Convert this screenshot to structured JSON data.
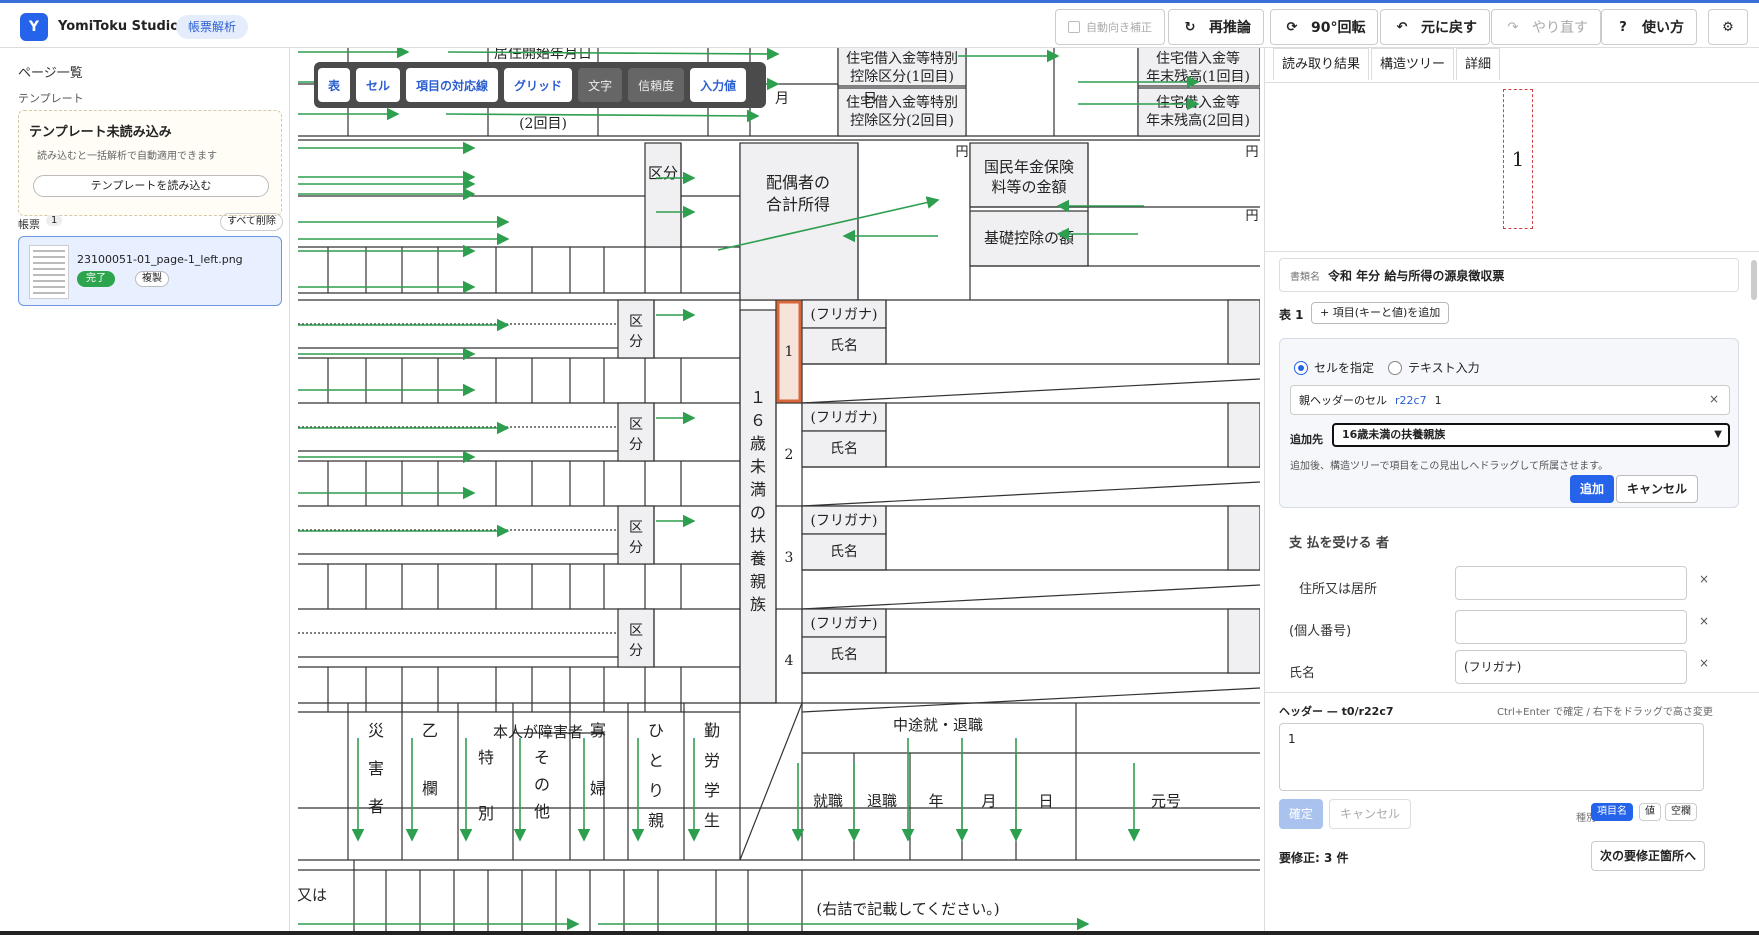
{
  "header": {
    "logo_letter": "Y",
    "app_title": "YomiToku Studio",
    "mode_badge": "帳票解析",
    "auto_orient_label": "自動向き補正",
    "reinfer_label": "再推論",
    "rotate_label": "90°回転",
    "undo_label": "元に戻す",
    "redo_label": "やり直す",
    "help_label": "使い方",
    "settings_icon": "gear-icon"
  },
  "sidebar": {
    "page_list_title": "ページ一覧",
    "template_label": "テンプレート",
    "template_box": {
      "title": "テンプレート未読み込み",
      "desc": "読み込むと一括解析で自動適用できます",
      "load_button": "テンプレートを読み込む"
    },
    "forms_label": "帳票",
    "forms_count": "1",
    "delete_all": "すべて削除",
    "file": {
      "name": "23100051-01_page-1_left.png",
      "status": "完了",
      "duplicate": "複製"
    }
  },
  "toolbar": {
    "items": [
      "表",
      "セル",
      "項目の対応線",
      "グリッド",
      "文字",
      "信頼度",
      "入力値"
    ]
  },
  "document": {
    "texts": {
      "resident_start_1": "居住開始年月日",
      "resident_start_2": "(2回目)",
      "loan_class_1": "住宅借入金等特別",
      "loan_class_1b": "控除区分(1回目)",
      "loan_class_2": "住宅借入金等特別",
      "loan_class_2b": "控除区分(2回目)",
      "loan_bal_1": "住宅借入金等",
      "loan_bal_1b": "年末残高(1回目)",
      "loan_bal_2": "住宅借入金等",
      "loan_bal_2b": "年末残高(2回目)",
      "month": "月",
      "day": "日",
      "yen": "円",
      "spouse_income": "配偶者の",
      "spouse_income_b": "合計所得",
      "pension": "国民年金保険",
      "pension_b": "料等の金額",
      "basic_deduction": "基礎控除の額",
      "kubun": "区分",
      "furigana": "(フリガナ)",
      "shimei": "氏名",
      "dependents_vertical": "16歳未満の扶養親族",
      "row_numbers": [
        "1",
        "2",
        "3",
        "4"
      ],
      "disaster": "災害者",
      "otsu": "乙欄",
      "self_disabled": "本人が障害者",
      "special": "特別",
      "other": "その他",
      "widow": "寡婦",
      "single_parent": "ひとり親",
      "working_student": "勤労学生",
      "midyear": "中途就・退職",
      "hire": "就職",
      "retire": "退職",
      "year": "年",
      "era": "元号",
      "right_note": "(右詰で記載してください。)",
      "partial_left_1": "又は"
    }
  },
  "right_panel": {
    "tabs": [
      "読み取り結果",
      "構造ツリー",
      "詳細"
    ],
    "preview_text": "1",
    "doc_name_label": "書類名",
    "doc_name_value": "令和 年分 給与所得の源泉徴収票",
    "table_label": "表 1",
    "add_item_button": "+ 項目(キーと値)を追加",
    "radio_cell": "セルを指定",
    "radio_text": "テキスト入力",
    "parent_cell_label": "親ヘッダーのセル",
    "parent_cell_ref": "r22c7",
    "parent_cell_value": "1",
    "dest_label": "追加先",
    "dest_value": "16歳未満の扶養親族",
    "hint": "追加後、構造ツリーで項目をこの見出しへドラッグして所属させます。",
    "add_button": "追加",
    "cancel_button": "キャンセル",
    "section_title": "支 払を受ける 者",
    "fields": [
      {
        "label": "住所又は居所",
        "value": ""
      },
      {
        "label": "(個人番号)",
        "value": ""
      },
      {
        "label": "氏名",
        "value": "(フリガナ)"
      }
    ],
    "header_editor": {
      "label": "ヘッダー — t0/r22c7",
      "hint": "Ctrl+Enter で確定 / 右下をドラッグで高さ変更",
      "value": "1",
      "confirm": "確定",
      "cancel": "キャンセル",
      "kind_label": "種別",
      "kinds": [
        "項目名",
        "値",
        "空欄"
      ]
    },
    "fix_count": "要修正: 3 件",
    "next_fix": "次の要修正箇所へ"
  },
  "colors": {
    "accent": "#2563eb",
    "arrow_green": "#2e9e4f",
    "selected_cell": "#d9663a",
    "done_badge": "#2da44e"
  }
}
